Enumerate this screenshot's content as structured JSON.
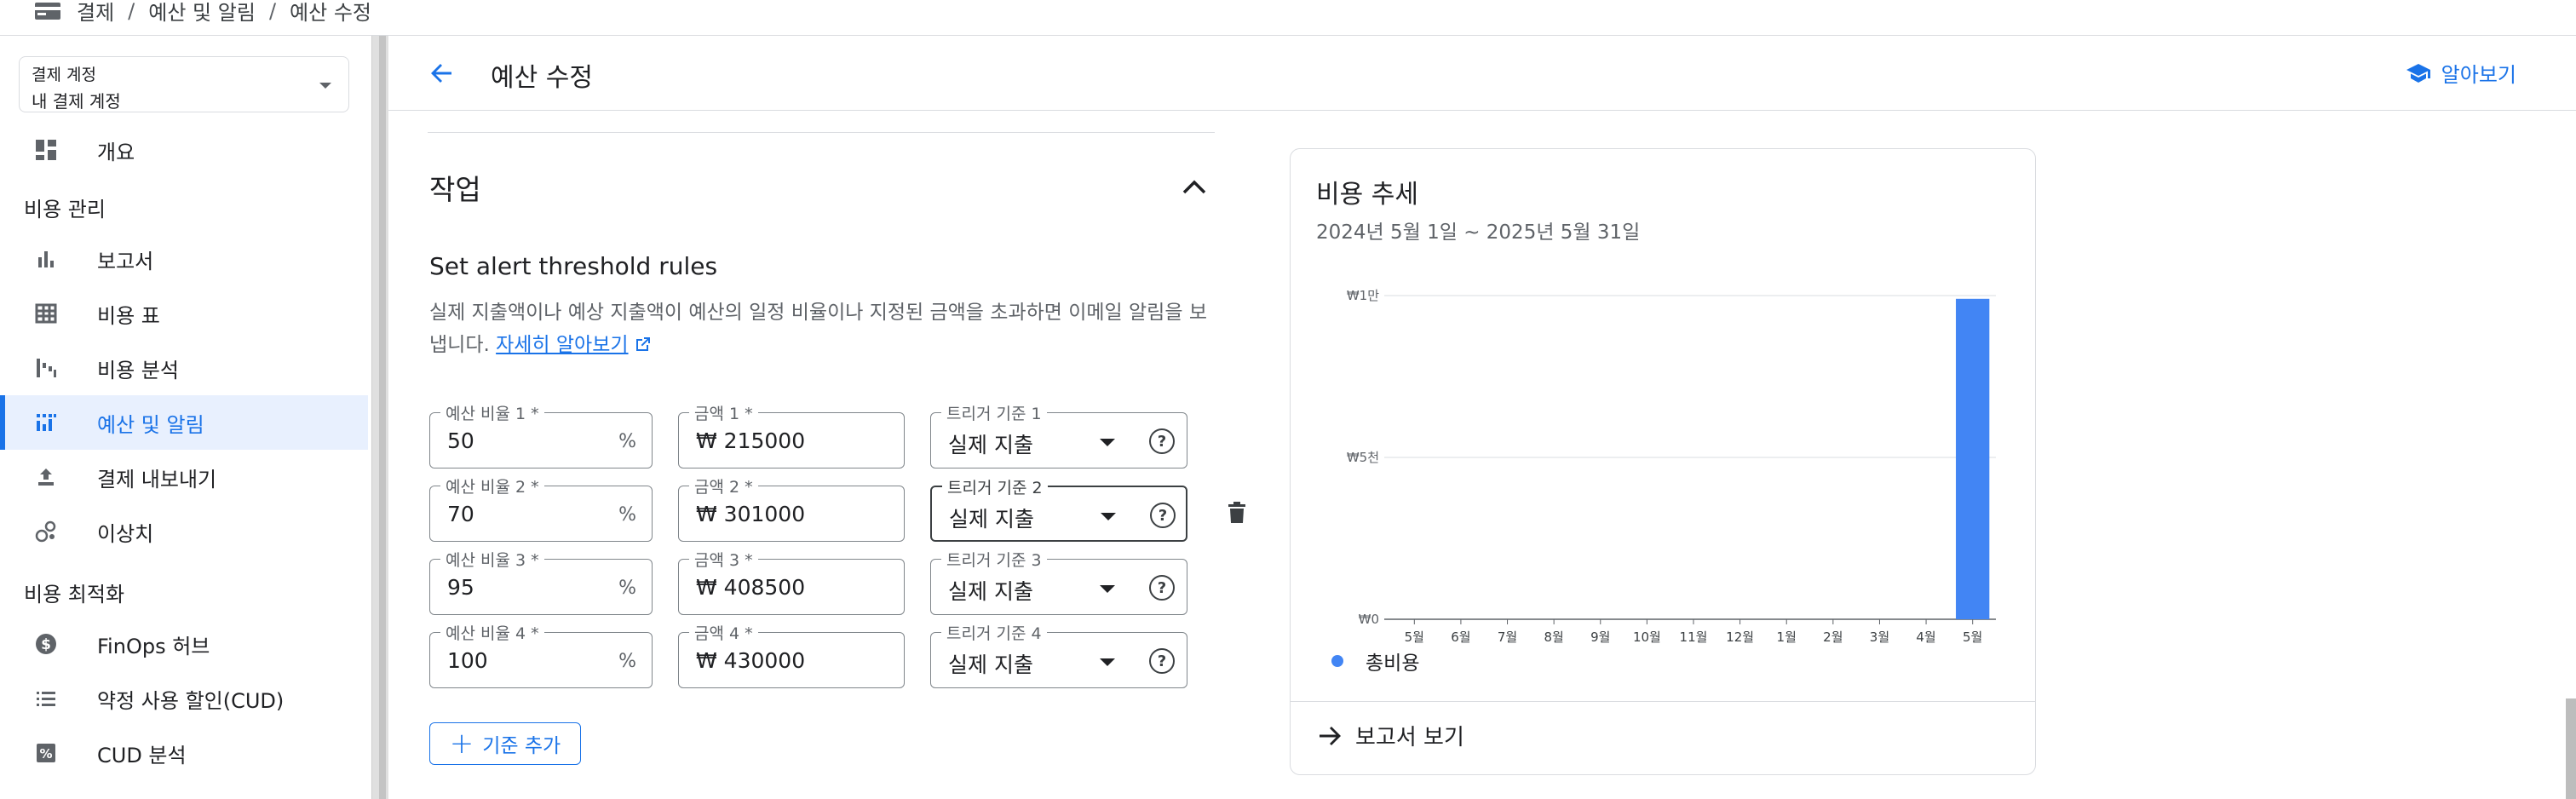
{
  "breadcrumb": {
    "items": [
      "결제",
      "예산 및 알림",
      "예산 수정"
    ],
    "separator": "/"
  },
  "sidebar": {
    "account_label": "결제 계정",
    "account_value": "내 결제 계정",
    "overview": "개요",
    "section_cost_mgmt": "비용 관리",
    "reports": "보고서",
    "cost_table": "비용 표",
    "cost_breakdown": "비용 분석",
    "budgets_alerts": "예산 및 알림",
    "billing_export": "결제 내보내기",
    "anomalies": "이상치",
    "section_cost_opt": "비용 최적화",
    "finops_hub": "FinOps 허브",
    "cud": "약정 사용 할인(CUD)",
    "cud_analysis": "CUD 분석"
  },
  "header": {
    "title": "예산 수정",
    "learn": "알아보기"
  },
  "actions": {
    "section_title": "작업",
    "rules_title": "Set alert threshold rules",
    "rules_desc": "실제 지출액이나 예상 지출액이 예산의 일정 비율이나 지정된 금액을 초과하면 이메일 알림을 보냅니다.",
    "learn_more": "자세히 알아보기",
    "add_rule": "기준 추가",
    "rules": [
      {
        "pct_label": "예산 비율 1 *",
        "pct": "50",
        "amt_label": "금액 1 *",
        "amt": "₩ 215000",
        "trig_label": "트리거 기준 1",
        "trig": "실제 지출"
      },
      {
        "pct_label": "예산 비율 2 *",
        "pct": "70",
        "amt_label": "금액 2 *",
        "amt": "₩ 301000",
        "trig_label": "트리거 기준 2",
        "trig": "실제 지출"
      },
      {
        "pct_label": "예산 비율 3 *",
        "pct": "95",
        "amt_label": "금액 3 *",
        "amt": "₩ 408500",
        "trig_label": "트리거 기준 3",
        "trig": "실제 지출"
      },
      {
        "pct_label": "예산 비율 4 *",
        "pct": "100",
        "amt_label": "금액 4 *",
        "amt": "₩ 430000",
        "trig_label": "트리거 기준 4",
        "trig": "실제 지출"
      }
    ],
    "pct_suffix": "%"
  },
  "card": {
    "title": "비용 추세",
    "subtitle": "2024년 5월 1일 ~ 2025년 5월 31일",
    "report_link": "보고서 보기"
  },
  "chart_data": {
    "type": "bar",
    "categories": [
      "5월",
      "6월",
      "7월",
      "8월",
      "9월",
      "10월",
      "11월",
      "12월",
      "1월",
      "2월",
      "3월",
      "4월",
      "5월"
    ],
    "series": [
      {
        "name": "총비용",
        "values": [
          0,
          0,
          0,
          0,
          0,
          0,
          0,
          0,
          0,
          0,
          0,
          0,
          9900
        ]
      }
    ],
    "ylim": [
      0,
      10000
    ],
    "yticks": [
      {
        "value": 0,
        "label": "₩0"
      },
      {
        "value": 5000,
        "label": "₩5천"
      },
      {
        "value": 10000,
        "label": "₩1만"
      }
    ],
    "grid": true,
    "color": "#4285f4",
    "legend_position": "bottom-left"
  },
  "colors": {
    "accent": "#1a73e8",
    "active_bg": "#e8f0fe",
    "bar": "#4285f4"
  }
}
